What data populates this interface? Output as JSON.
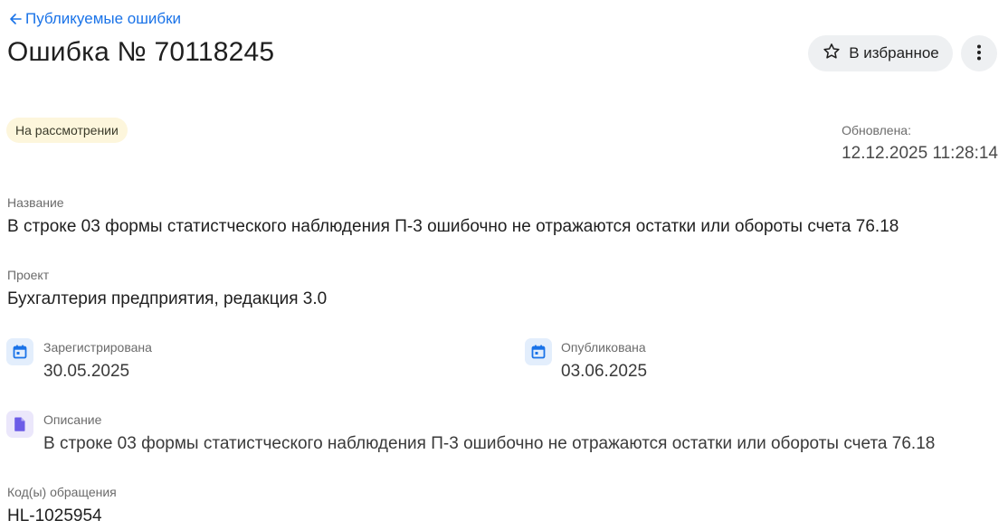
{
  "back_link": {
    "label": "Публикуемые ошибки",
    "icon": "arrow-left-icon"
  },
  "title": "Ошибка № 70118245",
  "actions": {
    "favorite_label": "В избранное",
    "favorite_icon": "star-outline-icon",
    "more_icon": "more-vertical-icon"
  },
  "status": {
    "label": "На рассмотрении",
    "color": "#fdf6dc"
  },
  "updated": {
    "label": "Обновлена:",
    "value": "12.12.2025 11:28:14"
  },
  "name_field": {
    "label": "Название",
    "value": "В строке 03 формы статистческого наблюдения П-3 ошибочно не отражаются остатки или обороты счета 76.18"
  },
  "project_field": {
    "label": "Проект",
    "value": "Бухгалтерия предприятия, редакция 3.0"
  },
  "registered": {
    "label": "Зарегистрирована",
    "value": "30.05.2025",
    "icon": "calendar-icon"
  },
  "published": {
    "label": "Опубликована",
    "value": "03.06.2025",
    "icon": "calendar-icon"
  },
  "description": {
    "label": "Описание",
    "value": "В строке 03 формы статистческого наблюдения П-3 ошибочно не отражаются остатки или обороты счета 76.18",
    "icon": "document-icon"
  },
  "request_codes": {
    "label": "Код(ы) обращения",
    "value": "HL-1025954"
  },
  "colors": {
    "link": "#1a73e8",
    "icon_blue": "#1a73e8",
    "icon_purple": "#6c5ce7"
  }
}
